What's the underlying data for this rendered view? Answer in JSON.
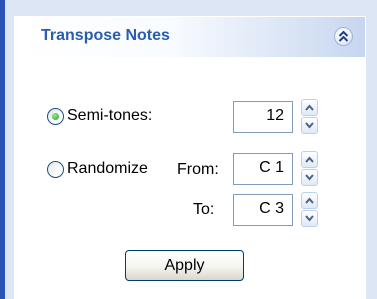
{
  "panel": {
    "title": "Transpose Notes"
  },
  "options": {
    "semitones": {
      "label": "Semi-tones:",
      "selected": true,
      "value": "12"
    },
    "randomize": {
      "label": "Randomize",
      "selected": false,
      "from_label": "From:",
      "from_value": "C 1",
      "to_label": "To:",
      "to_value": "C 3"
    }
  },
  "actions": {
    "apply_label": "Apply"
  },
  "icons": {
    "collapse": "double-chevron-up-icon",
    "spin_up": "chevron-up-icon",
    "spin_down": "chevron-down-icon"
  },
  "colors": {
    "title": "#2a5db0",
    "accent_border": "#2b52b6",
    "panel_background": "#eef3fb",
    "radio_selected": "#21a121"
  }
}
